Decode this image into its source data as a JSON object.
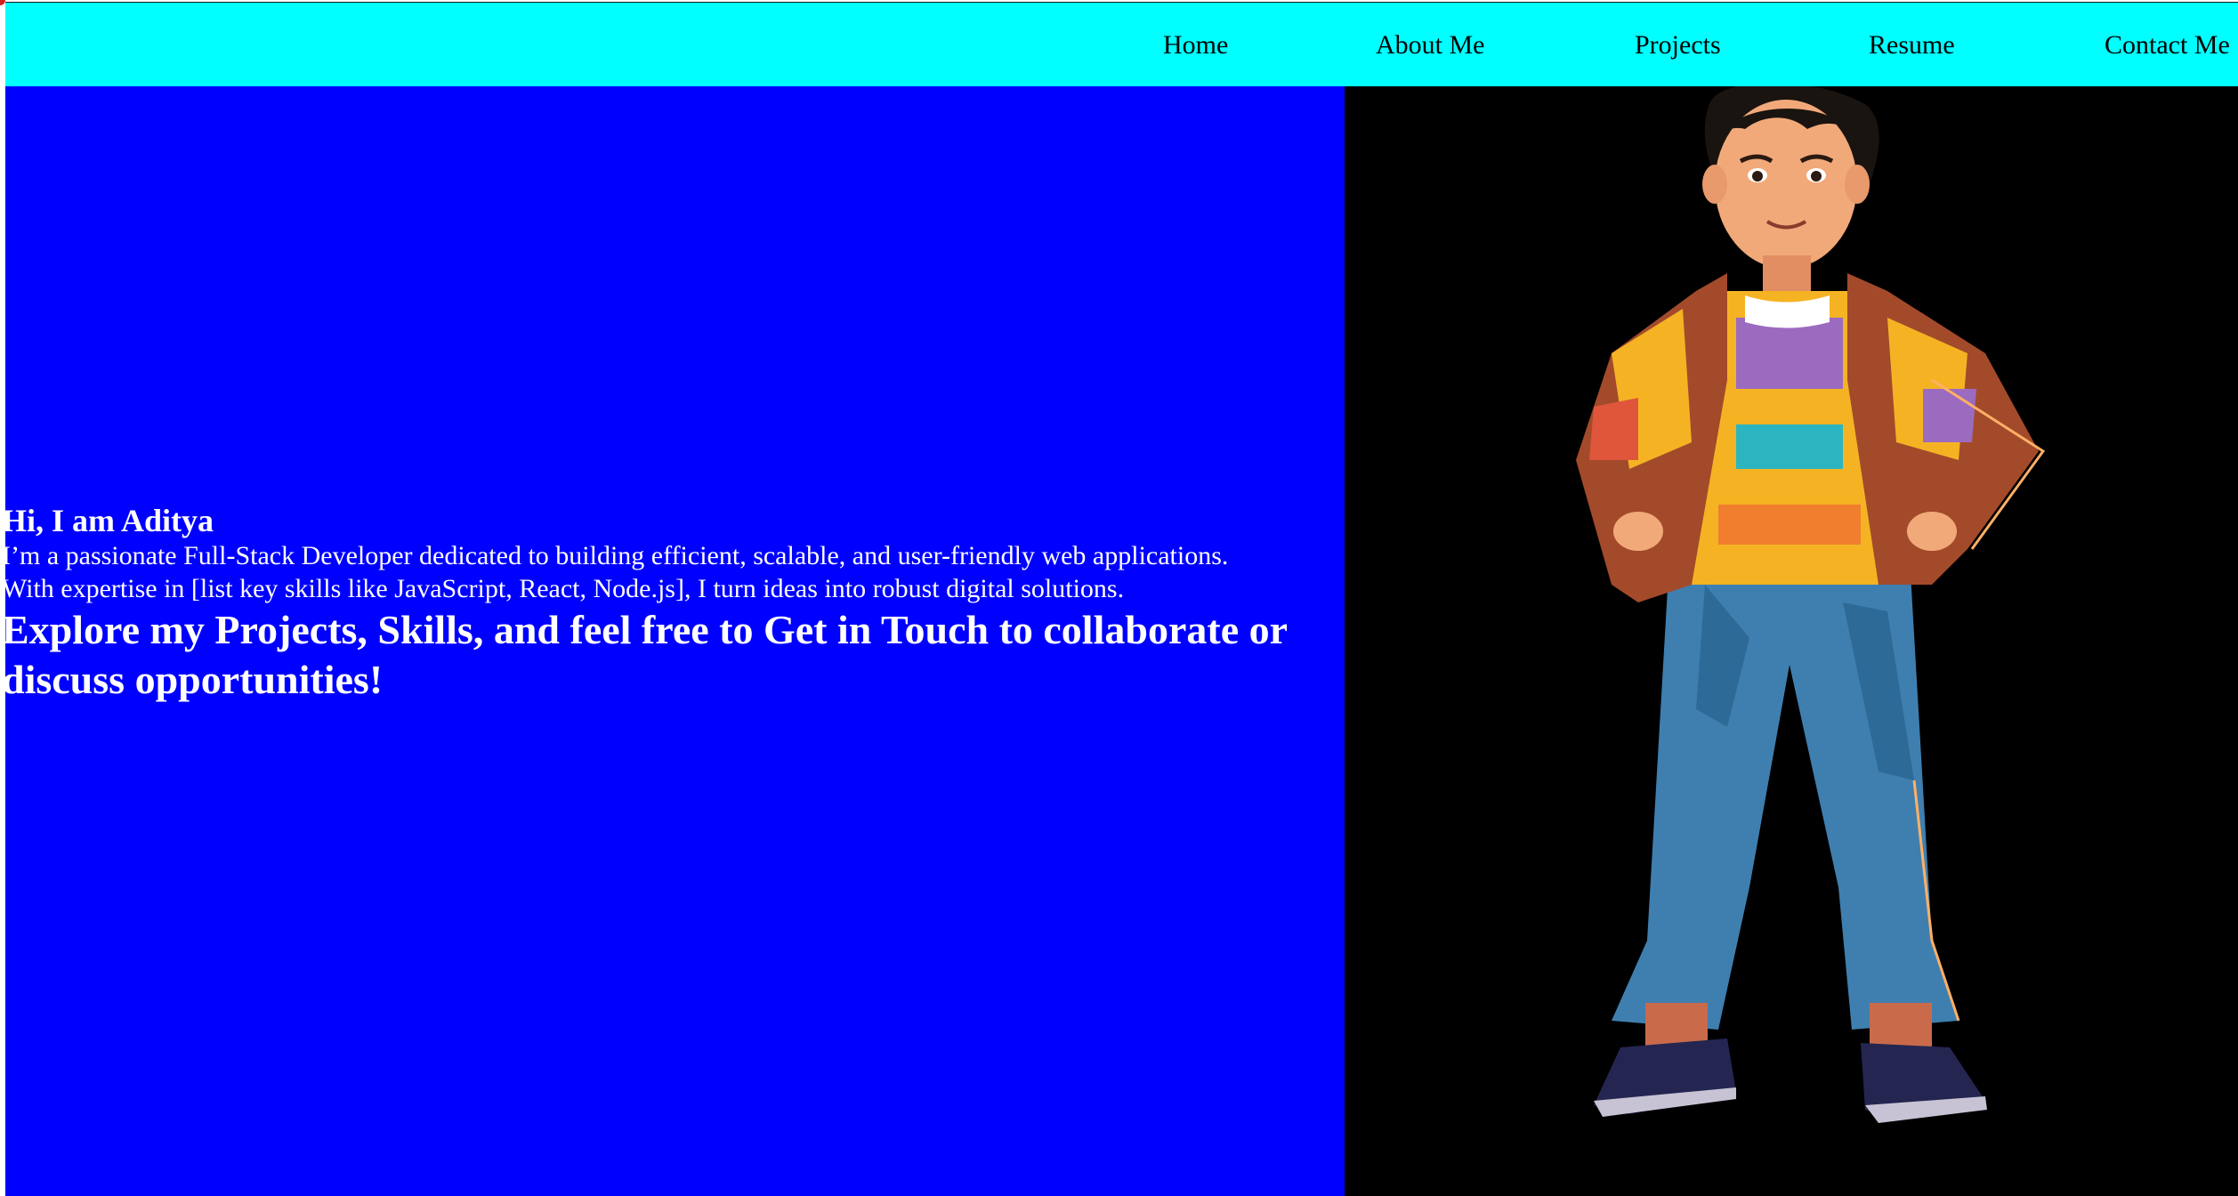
{
  "nav": {
    "items": [
      {
        "label": "Home"
      },
      {
        "label": "About Me"
      },
      {
        "label": "Projects"
      },
      {
        "label": "Resume"
      },
      {
        "label": "Contact Me"
      }
    ]
  },
  "hero": {
    "greeting": "Hi, I am Aditya",
    "intro_line1": "I’m a passionate Full-Stack Developer dedicated to building efficient, scalable, and user-friendly web applications.",
    "intro_line2": "With expertise in [list key skills like JavaScript, React, Node.js], I turn ideas into robust digital solutions.",
    "cta": "Explore my Projects, Skills, and feel free to Get in Touch to collaborate or discuss opportunities!"
  },
  "colors": {
    "navbar_bg": "#00ffff",
    "hero_left_bg": "#0000ff",
    "hero_right_bg": "#000000",
    "hero_text": "#ffffff",
    "nav_text": "#000000"
  },
  "illustration": {
    "icon": "cartoon-developer-avatar"
  }
}
